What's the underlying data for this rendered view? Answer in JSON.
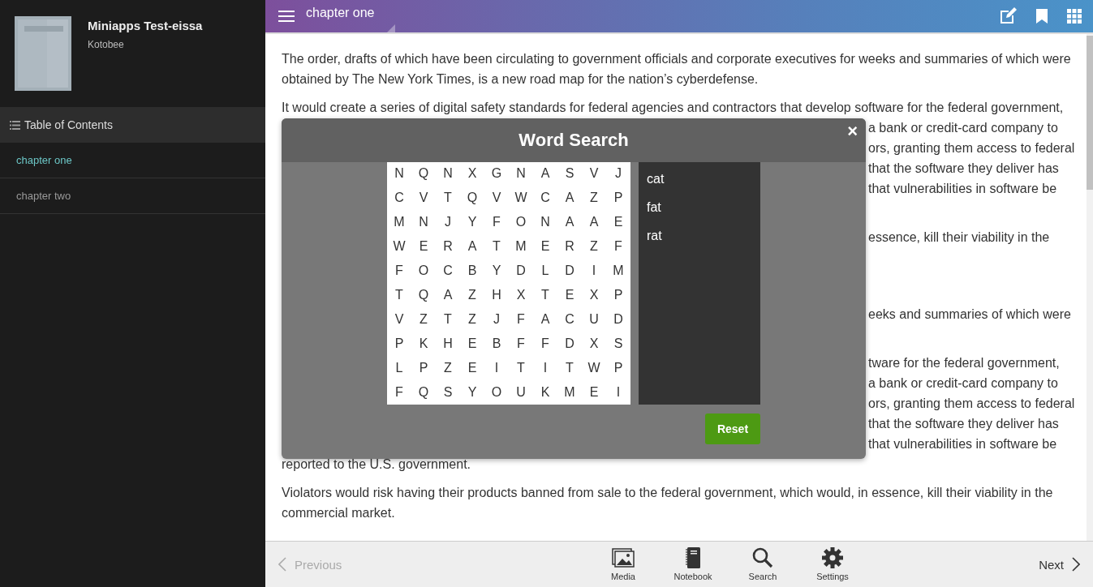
{
  "sidebar": {
    "book": {
      "title": "Miniapps Test-eissa",
      "author": "Kotobee"
    },
    "toc_header": "Table of Contents",
    "chapters": [
      {
        "label": "chapter one",
        "selected": true
      },
      {
        "label": "chapter two",
        "selected": false
      }
    ]
  },
  "header": {
    "title": "chapter one"
  },
  "content": {
    "blocks": [
      {
        "kind": "paragraph",
        "text": "The order, drafts of which have been circulating to government officials and corporate executives for weeks and summaries of which were obtained by The New York Times, is a new road map for the nation’s cyberdefense."
      },
      {
        "kind": "line",
        "text": "It would create a series of digital safety standards for federal agencies and contractors that develop software for the federal government,"
      },
      {
        "kind": "beside_dialog",
        "groups": [
          [
            "a bank or credit-card company to",
            "ors, granting them access to federal",
            "that the software they deliver has",
            "that vulnerabilities in software be"
          ],
          [
            "essence, kill their viability in the"
          ],
          [
            "eeks and summaries of which were"
          ],
          [
            "tware for the federal government,",
            "a bank or credit-card company to",
            "ors, granting them access to federal",
            "that the software they deliver has",
            "that vulnerabilities in software be"
          ]
        ]
      },
      {
        "kind": "line",
        "text": "reported to the U.S. government."
      },
      {
        "kind": "paragraph",
        "text": "Violators would risk having their products banned from sale to the federal government, which would, in essence, kill their viability in the commercial market."
      }
    ]
  },
  "word_search": {
    "title": "Word Search",
    "close": "×",
    "grid": [
      [
        "N",
        "Q",
        "N",
        "X",
        "G",
        "N",
        "A",
        "S",
        "V",
        "J"
      ],
      [
        "C",
        "V",
        "T",
        "Q",
        "V",
        "W",
        "C",
        "A",
        "Z",
        "P"
      ],
      [
        "M",
        "N",
        "J",
        "Y",
        "F",
        "O",
        "N",
        "A",
        "A",
        "E"
      ],
      [
        "W",
        "E",
        "R",
        "A",
        "T",
        "M",
        "E",
        "R",
        "Z",
        "F"
      ],
      [
        "F",
        "O",
        "C",
        "B",
        "Y",
        "D",
        "L",
        "D",
        "I",
        "M"
      ],
      [
        "T",
        "Q",
        "A",
        "Z",
        "H",
        "X",
        "T",
        "E",
        "X",
        "P"
      ],
      [
        "V",
        "Z",
        "T",
        "Z",
        "J",
        "F",
        "A",
        "C",
        "U",
        "D"
      ],
      [
        "P",
        "K",
        "H",
        "E",
        "B",
        "F",
        "F",
        "D",
        "X",
        "S"
      ],
      [
        "L",
        "P",
        "Z",
        "E",
        "I",
        "T",
        "I",
        "T",
        "W",
        "P"
      ],
      [
        "F",
        "Q",
        "S",
        "Y",
        "O",
        "U",
        "K",
        "M",
        "E",
        "I"
      ]
    ],
    "words": [
      "cat",
      "fat",
      "rat"
    ],
    "reset": "Reset"
  },
  "footer": {
    "previous": {
      "label": "Previous",
      "disabled": true
    },
    "next": {
      "label": "Next",
      "disabled": false
    },
    "tools": [
      {
        "kind": "media",
        "label": "Media"
      },
      {
        "kind": "notebook",
        "label": "Notebook"
      },
      {
        "kind": "search",
        "label": "Search"
      },
      {
        "kind": "settings",
        "label": "Settings"
      }
    ]
  }
}
